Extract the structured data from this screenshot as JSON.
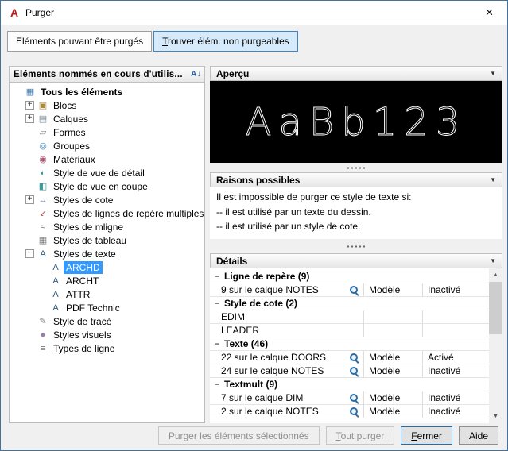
{
  "window": {
    "title": "Purger"
  },
  "icons": {
    "app": "A",
    "close": "×",
    "chevron_down": "▼",
    "expand": "+",
    "collapse": "−",
    "scroll_up": "▲",
    "scroll_down": "▼",
    "sort": "A↓"
  },
  "tabs": [
    {
      "id": "purgeable",
      "label": "Eléments pouvant être purgés",
      "mnemonic": null,
      "active": false
    },
    {
      "id": "non-purgeable",
      "label": "Trouver élém. non purgeables",
      "mnemonic": 0,
      "active": true
    }
  ],
  "left_panel": {
    "header": "Eléments nommés en cours d'utilis...",
    "tree": [
      {
        "label": "Tous les éléments",
        "depth": 0,
        "expander": "none",
        "bold": true,
        "icon": {
          "name": "all-elements-icon",
          "glyph": "▦",
          "color": "#4a7fb5"
        }
      },
      {
        "label": "Blocs",
        "depth": 1,
        "expander": "plus",
        "icon": {
          "name": "block-icon",
          "glyph": "▣",
          "color": "#a8893d"
        }
      },
      {
        "label": "Calques",
        "depth": 1,
        "expander": "plus",
        "icon": {
          "name": "layers-icon",
          "glyph": "▤",
          "color": "#7d8a94"
        }
      },
      {
        "label": "Formes",
        "depth": 1,
        "expander": "none",
        "icon": {
          "name": "shapes-icon",
          "glyph": "▱",
          "color": "#8a8a8a"
        }
      },
      {
        "label": "Groupes",
        "depth": 1,
        "expander": "none",
        "icon": {
          "name": "groups-icon",
          "glyph": "◎",
          "color": "#4a90c4"
        }
      },
      {
        "label": "Matériaux",
        "depth": 1,
        "expander": "none",
        "icon": {
          "name": "materials-icon",
          "glyph": "◉",
          "color": "#b05c7a"
        }
      },
      {
        "label": "Style de vue de détail",
        "depth": 1,
        "expander": "none",
        "icon": {
          "name": "detail-view-style-icon",
          "glyph": "◐",
          "color": "#3a9a9a"
        }
      },
      {
        "label": "Style de vue en coupe",
        "depth": 1,
        "expander": "none",
        "icon": {
          "name": "section-view-style-icon",
          "glyph": "◧",
          "color": "#3a9a9a"
        }
      },
      {
        "label": "Styles de cote",
        "depth": 1,
        "expander": "plus",
        "icon": {
          "name": "dimension-style-icon",
          "glyph": "↔",
          "color": "#4a7ab0"
        }
      },
      {
        "label": "Styles de lignes de repère multiples",
        "depth": 1,
        "expander": "none",
        "icon": {
          "name": "multileader-style-icon",
          "glyph": "↙",
          "color": "#b05050"
        }
      },
      {
        "label": "Styles de mligne",
        "depth": 1,
        "expander": "none",
        "icon": {
          "name": "mline-style-icon",
          "glyph": "≈",
          "color": "#777777"
        }
      },
      {
        "label": "Styles de tableau",
        "depth": 1,
        "expander": "none",
        "icon": {
          "name": "table-style-icon",
          "glyph": "▦",
          "color": "#777777"
        }
      },
      {
        "label": "Styles de texte",
        "depth": 1,
        "expander": "minus",
        "icon": {
          "name": "text-style-icon",
          "glyph": "A",
          "color": "#2f5a7d"
        }
      },
      {
        "label": "ARCHD",
        "depth": 2,
        "expander": "none",
        "selected": true,
        "icon": {
          "name": "text-style-item-icon",
          "glyph": "A",
          "color": "#2f5a7d"
        }
      },
      {
        "label": "ARCHT",
        "depth": 2,
        "expander": "none",
        "icon": {
          "name": "text-style-item-icon",
          "glyph": "A",
          "color": "#2f5a7d"
        }
      },
      {
        "label": "ATTR",
        "depth": 2,
        "expander": "none",
        "icon": {
          "name": "text-style-item-icon",
          "glyph": "A",
          "color": "#2f5a7d"
        }
      },
      {
        "label": "PDF Technic",
        "depth": 2,
        "expander": "none",
        "icon": {
          "name": "text-style-item-icon",
          "glyph": "A",
          "color": "#2f5a7d"
        }
      },
      {
        "label": "Style de tracé",
        "depth": 1,
        "expander": "none",
        "icon": {
          "name": "plot-style-icon",
          "glyph": "✎",
          "color": "#777777"
        }
      },
      {
        "label": "Styles visuels",
        "depth": 1,
        "expander": "none",
        "icon": {
          "name": "visual-style-icon",
          "glyph": "●",
          "color": "#9a7ab0"
        }
      },
      {
        "label": "Types de ligne",
        "depth": 1,
        "expander": "none",
        "icon": {
          "name": "linetype-icon",
          "glyph": "≡",
          "color": "#777777"
        }
      }
    ]
  },
  "preview": {
    "header": "Aperçu",
    "sample_text": "AaBb123"
  },
  "reasons": {
    "header": "Raisons possibles",
    "lines": [
      "Il est impossible de purger ce style de texte si:",
      "-- il est utilisé par un texte du dessin.",
      "-- il est utilisé par un style de cote."
    ]
  },
  "details": {
    "header": "Détails",
    "rows": [
      {
        "type": "group",
        "label": "Ligne de repère (9)"
      },
      {
        "type": "item",
        "name": "9 sur le calque NOTES",
        "zoom": true,
        "space": "Modèle",
        "status": "Inactivé"
      },
      {
        "type": "group",
        "label": "Style de cote (2)"
      },
      {
        "type": "item",
        "name": "EDIM",
        "zoom": false,
        "space": "",
        "status": ""
      },
      {
        "type": "item",
        "name": "LEADER",
        "zoom": false,
        "space": "",
        "status": ""
      },
      {
        "type": "group",
        "label": "Texte (46)"
      },
      {
        "type": "item",
        "name": "22 sur le calque DOORS",
        "zoom": true,
        "space": "Modèle",
        "status": "Activé"
      },
      {
        "type": "item",
        "name": "24 sur le calque NOTES",
        "zoom": true,
        "space": "Modèle",
        "status": "Inactivé"
      },
      {
        "type": "group",
        "label": "Textmult (9)"
      },
      {
        "type": "item",
        "name": "7 sur le calque DIM",
        "zoom": true,
        "space": "Modèle",
        "status": "Inactivé"
      },
      {
        "type": "item",
        "name": "2 sur le calque NOTES",
        "zoom": true,
        "space": "Modèle",
        "status": "Inactivé"
      }
    ]
  },
  "footer": {
    "buttons": [
      {
        "id": "purge-selected",
        "label": "Purger les éléments sélectionnés",
        "mnemonic": null,
        "enabled": false,
        "default": false
      },
      {
        "id": "purge-all",
        "label": "Tout purger",
        "mnemonic": 0,
        "enabled": false,
        "default": false
      },
      {
        "id": "close",
        "label": "Fermer",
        "mnemonic": 0,
        "enabled": true,
        "default": true
      },
      {
        "id": "help",
        "label": "Aide",
        "mnemonic": null,
        "enabled": true,
        "default": false
      }
    ]
  },
  "colors": {
    "selection": "#3399ff",
    "accent": "#0078d4",
    "tab_active_bg": "#d5eafb",
    "tab_active_border": "#3d85c0",
    "app_icon_red": "#c21a1a"
  }
}
